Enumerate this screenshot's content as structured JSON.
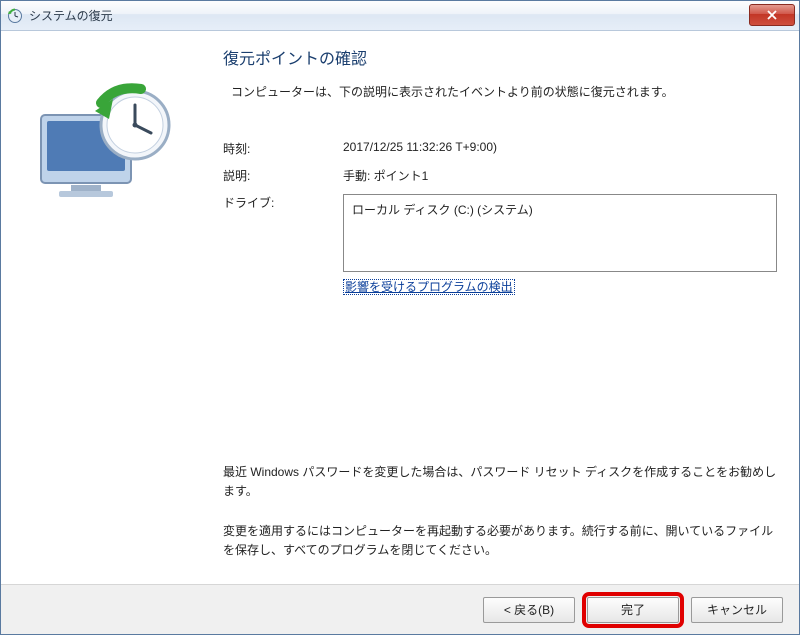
{
  "window": {
    "title": "システムの復元"
  },
  "main": {
    "heading": "復元ポイントの確認",
    "subdesc": "コンピューターは、下の説明に表示されたイベントより前の状態に復元されます。",
    "rows": {
      "time_label": "時刻:",
      "time_value": "2017/12/25 11:32:26  T+9:00)",
      "desc_label": "説明:",
      "desc_value": "手動: ポイント1",
      "drive_label": "ドライブ:",
      "drive_value": "ローカル ディスク (C:) (システム)"
    },
    "link": "影響を受けるプログラムの検出",
    "note_password": "最近 Windows パスワードを変更した場合は、パスワード リセット ディスクを作成することをお勧めします。",
    "note_restart": "変更を適用するにはコンピューターを再起動する必要があります。続行する前に、開いているファイルを保存し、すべてのプログラムを閉じてください。"
  },
  "buttons": {
    "back": "< 戻る(B)",
    "finish": "完了",
    "cancel": "キャンセル"
  }
}
